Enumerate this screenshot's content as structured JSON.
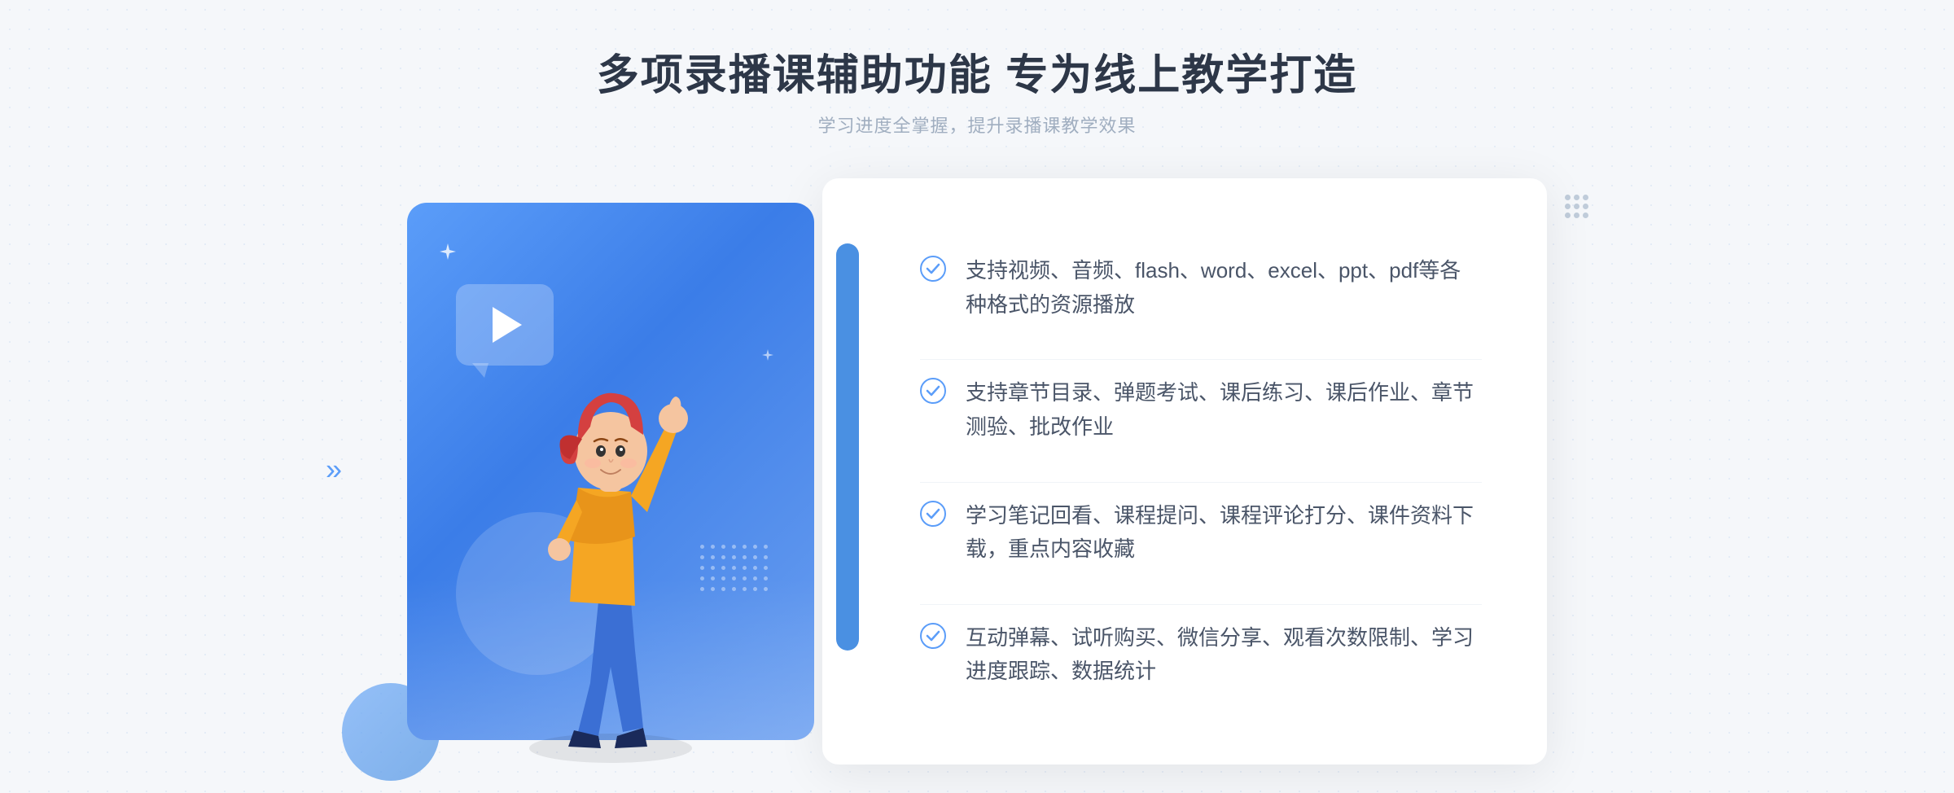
{
  "page": {
    "background_color": "#f5f7fa"
  },
  "header": {
    "main_title": "多项录播课辅助功能 专为线上教学打造",
    "subtitle": "学习进度全掌握，提升录播课教学效果"
  },
  "features": [
    {
      "id": 1,
      "text": "支持视频、音频、flash、word、excel、ppt、pdf等各种格式的资源播放"
    },
    {
      "id": 2,
      "text": "支持章节目录、弹题考试、课后练习、课后作业、章节测验、批改作业"
    },
    {
      "id": 3,
      "text": "学习笔记回看、课程提问、课程评论打分、课件资料下载，重点内容收藏"
    },
    {
      "id": 4,
      "text": "互动弹幕、试听购买、微信分享、观看次数限制、学习进度跟踪、数据统计"
    }
  ],
  "icons": {
    "check": "check-circle-icon",
    "play": "play-icon",
    "chevron_left": "«"
  },
  "colors": {
    "primary_blue": "#4a90e2",
    "light_blue": "#6ba8f7",
    "text_dark": "#4a5568",
    "text_title": "#2d3748",
    "text_subtitle": "#a0aec0",
    "check_color": "#5b9df9",
    "border_color": "#f0f4f8"
  }
}
